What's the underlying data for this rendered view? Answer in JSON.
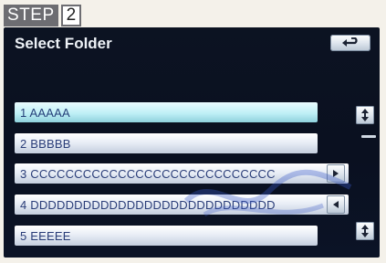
{
  "step": {
    "label": "STEP",
    "number": "2"
  },
  "screen": {
    "title": "Select Folder",
    "back_button": {
      "icon": "return-arrow-icon"
    },
    "folders": [
      {
        "label": "1  AAAAA",
        "selected": true
      },
      {
        "label": "2  BBBBB",
        "selected": false
      },
      {
        "label": "3  CCCCCCCCCCCCCCCCCCCCCCCCCCCC",
        "selected": false
      },
      {
        "label": "4  DDDDDDDDDDDDDDDDDDDDDDDDDDDD",
        "selected": false
      },
      {
        "label": "5  EEEEE",
        "selected": false
      }
    ],
    "row_buttons": {
      "row3": {
        "icon": "arrow-right-icon"
      },
      "row4": {
        "icon": "arrow-left-icon"
      }
    },
    "scroll_buttons": {
      "up": {
        "icon": "scroll-up-down-icon"
      },
      "down": {
        "icon": "scroll-up-down-icon"
      }
    }
  },
  "colors": {
    "screen_bg": "#0c1322",
    "row_text": "#2a3d78",
    "selected_row": "#bfeff6",
    "step_label_bg": "#6d6d72"
  }
}
